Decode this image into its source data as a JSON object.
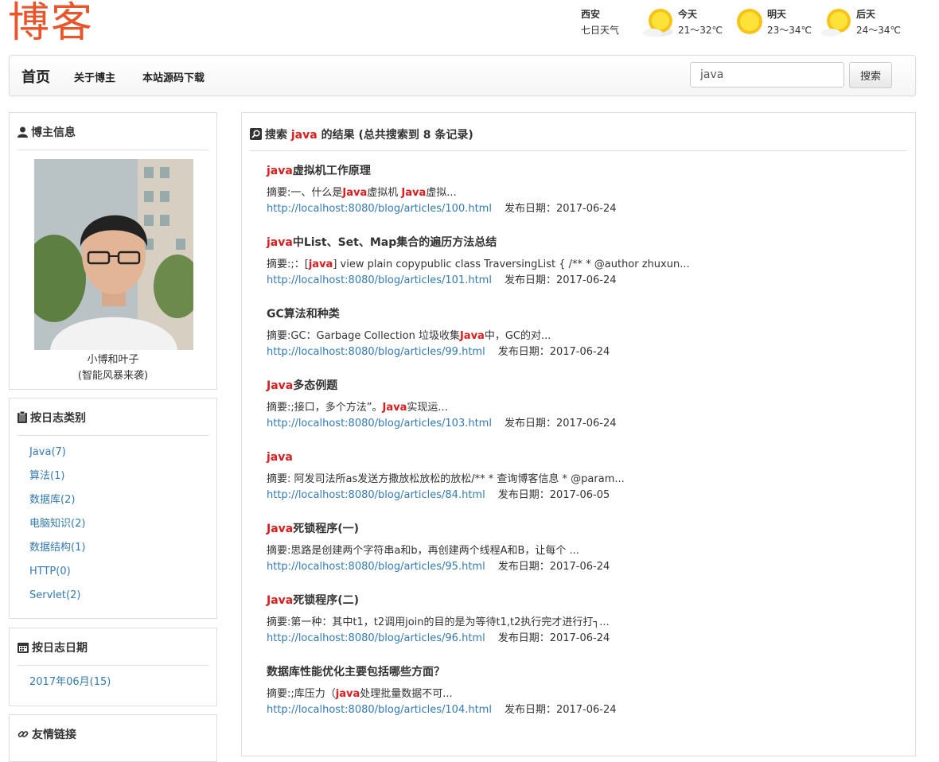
{
  "logo": "博客",
  "weather": {
    "city": "西安",
    "label": "七日天气",
    "days": [
      {
        "day": "今天",
        "temp": "21～32℃",
        "icon": "sunny-icon"
      },
      {
        "day": "明天",
        "temp": "23～34℃",
        "icon": "sunny-icon"
      },
      {
        "day": "后天",
        "temp": "24～34℃",
        "icon": "sunny-icon"
      }
    ]
  },
  "nav": {
    "brand": "首页",
    "links": [
      "关于博主",
      "本站源码下载"
    ],
    "search_value": "java",
    "search_button": "搜索"
  },
  "sidebar": {
    "profile_title": "博主信息",
    "name": "小博和叶子",
    "motto": "(智能风暴来袭)",
    "categories_title": "按日志类别",
    "categories": [
      "Java(7)",
      "算法(1)",
      "数据库(2)",
      "电脑知识(2)",
      "数据结构(1)",
      "HTTP(0)",
      "Servlet(2)"
    ],
    "dates_title": "按日志日期",
    "dates": [
      "2017年06月(15)"
    ],
    "links_title": "友情链接"
  },
  "results": {
    "prefix": "搜索 ",
    "keyword": "java",
    "suffix": " 的结果 (总共搜索到 8 条记录)",
    "date_label": "发布日期：",
    "items": [
      {
        "title_hl": "java",
        "title_rest": "虚拟机工作原理",
        "sum": [
          [
            "摘要:一、什么是",
            ""
          ],
          [
            "Java",
            "h"
          ],
          [
            "虚拟机 ",
            ""
          ],
          [
            "Java",
            "h"
          ],
          [
            "虚拟...",
            ""
          ]
        ],
        "url": "http://localhost:8080/blog/articles/100.html",
        "date": "2017-06-24"
      },
      {
        "title_hl": "java",
        "title_rest": "中List、Set、Map集合的遍历方法总结",
        "sum": [
          [
            "摘要:;：[",
            ""
          ],
          [
            "java",
            "h"
          ],
          [
            "] view plain copypublic class TraversingList { /** * @author zhuxun...",
            ""
          ]
        ],
        "url": "http://localhost:8080/blog/articles/101.html",
        "date": "2017-06-24"
      },
      {
        "title_hl": "",
        "title_rest": "GC算法和种类",
        "sum": [
          [
            "摘要:GC：Garbage Collection 垃圾收集",
            ""
          ],
          [
            "Java",
            "h"
          ],
          [
            "中，GC的对...",
            ""
          ]
        ],
        "url": "http://localhost:8080/blog/articles/99.html",
        "date": "2017-06-24"
      },
      {
        "title_hl": "Java",
        "title_rest": "多态例题",
        "sum": [
          [
            "摘要:;接口，多个方法”。",
            ""
          ],
          [
            "Java",
            "h"
          ],
          [
            "实现运...",
            ""
          ]
        ],
        "url": "http://localhost:8080/blog/articles/103.html",
        "date": "2017-06-24"
      },
      {
        "title_hl": "java",
        "title_rest": "",
        "sum": [
          [
            "摘要: 阿发司法所as发送方撒放松放松的放松/** * 查询博客信息 * @param...",
            ""
          ]
        ],
        "url": "http://localhost:8080/blog/articles/84.html",
        "date": "2017-06-05"
      },
      {
        "title_hl": "Java",
        "title_rest": "死锁程序(一)",
        "sum": [
          [
            "摘要:思路是创建两个字符串a和b，再创建两个线程A和B，让每个 ...",
            ""
          ]
        ],
        "url": "http://localhost:8080/blog/articles/95.html",
        "date": "2017-06-24"
      },
      {
        "title_hl": "Java",
        "title_rest": "死锁程序(二)",
        "sum": [
          [
            "摘要:第一种：其中t1，t2调用join的目的是为等待t1,t2执行完才进行打┐...",
            ""
          ]
        ],
        "url": "http://localhost:8080/blog/articles/96.html",
        "date": "2017-06-24"
      },
      {
        "title_hl": "",
        "title_rest": "数据库性能优化主要包括哪些方面？",
        "sum": [
          [
            "摘要:;库压力（",
            ""
          ],
          [
            "java",
            "h"
          ],
          [
            "处理批量数据不可...",
            ""
          ]
        ],
        "url": "http://localhost:8080/blog/articles/104.html",
        "date": "2017-06-24"
      }
    ]
  }
}
